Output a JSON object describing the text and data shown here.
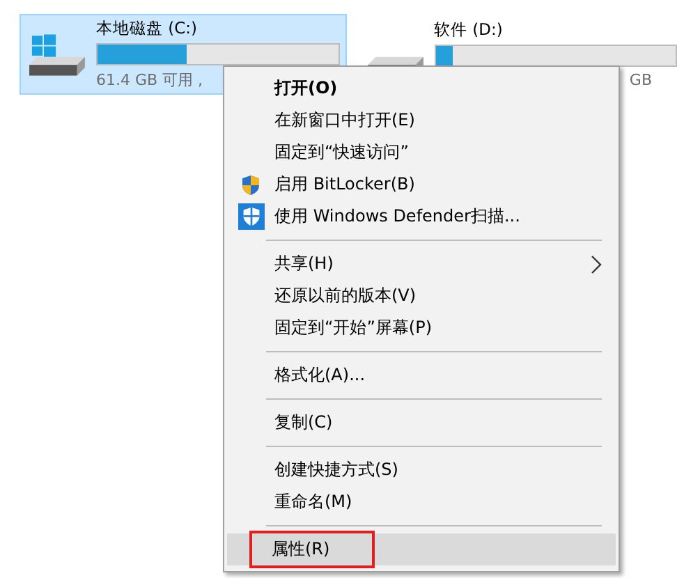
{
  "drives": [
    {
      "name": "本地磁盘 (C:)",
      "level": 0.37,
      "free_text": "61.4 GB 可用 ,",
      "selected": true,
      "system": true
    },
    {
      "name": "软件 (D:)",
      "level": 0.07,
      "free_text": "GB",
      "selected": false,
      "system": false
    }
  ],
  "context_menu": {
    "items": [
      {
        "kind": "item",
        "label": "打开(O)",
        "bold": true
      },
      {
        "kind": "item",
        "label": "在新窗口中打开(E)"
      },
      {
        "kind": "item",
        "label": "固定到“快速访问”"
      },
      {
        "kind": "shield",
        "label": "启用 BitLocker(B)"
      },
      {
        "kind": "scan",
        "label": "使用 Windows Defender扫描..."
      },
      {
        "kind": "separator"
      },
      {
        "kind": "item",
        "label": "共享(H)",
        "submenu": true
      },
      {
        "kind": "item",
        "label": "还原以前的版本(V)"
      },
      {
        "kind": "item",
        "label": "固定到“开始”屏幕(P)"
      },
      {
        "kind": "separator"
      },
      {
        "kind": "item",
        "label": "格式化(A)..."
      },
      {
        "kind": "separator"
      },
      {
        "kind": "item",
        "label": "复制(C)"
      },
      {
        "kind": "separator"
      },
      {
        "kind": "item",
        "label": "创建快捷方式(S)"
      },
      {
        "kind": "item",
        "label": "重命名(M)"
      },
      {
        "kind": "separator"
      },
      {
        "kind": "item",
        "label": "属性(R)",
        "selected": true,
        "outlined": true
      }
    ]
  }
}
